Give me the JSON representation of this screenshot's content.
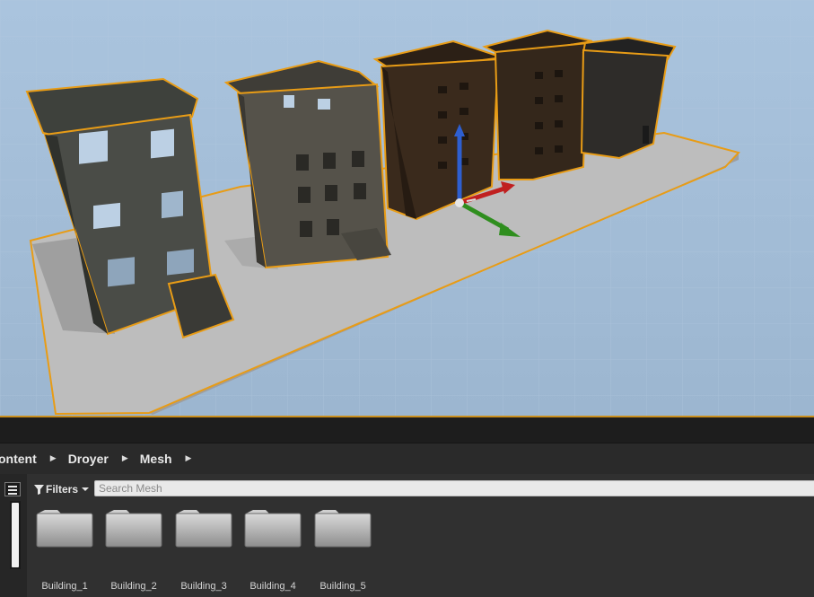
{
  "viewport": {
    "name": "3D level viewport",
    "sky_color": "#a4bed8",
    "selection_color": "#e89c16"
  },
  "content_browser": {
    "breadcrumb": [
      "ontent",
      "Droyer",
      "Mesh"
    ],
    "filters_label": "Filters",
    "search_placeholder": "Search Mesh",
    "folders": [
      {
        "label": "Building_1",
        "icon": "folder-icon"
      },
      {
        "label": "Building_2",
        "icon": "folder-icon"
      },
      {
        "label": "Building_3",
        "icon": "folder-icon"
      },
      {
        "label": "Building_4",
        "icon": "folder-icon"
      },
      {
        "label": "Building_5",
        "icon": "folder-icon"
      }
    ]
  }
}
